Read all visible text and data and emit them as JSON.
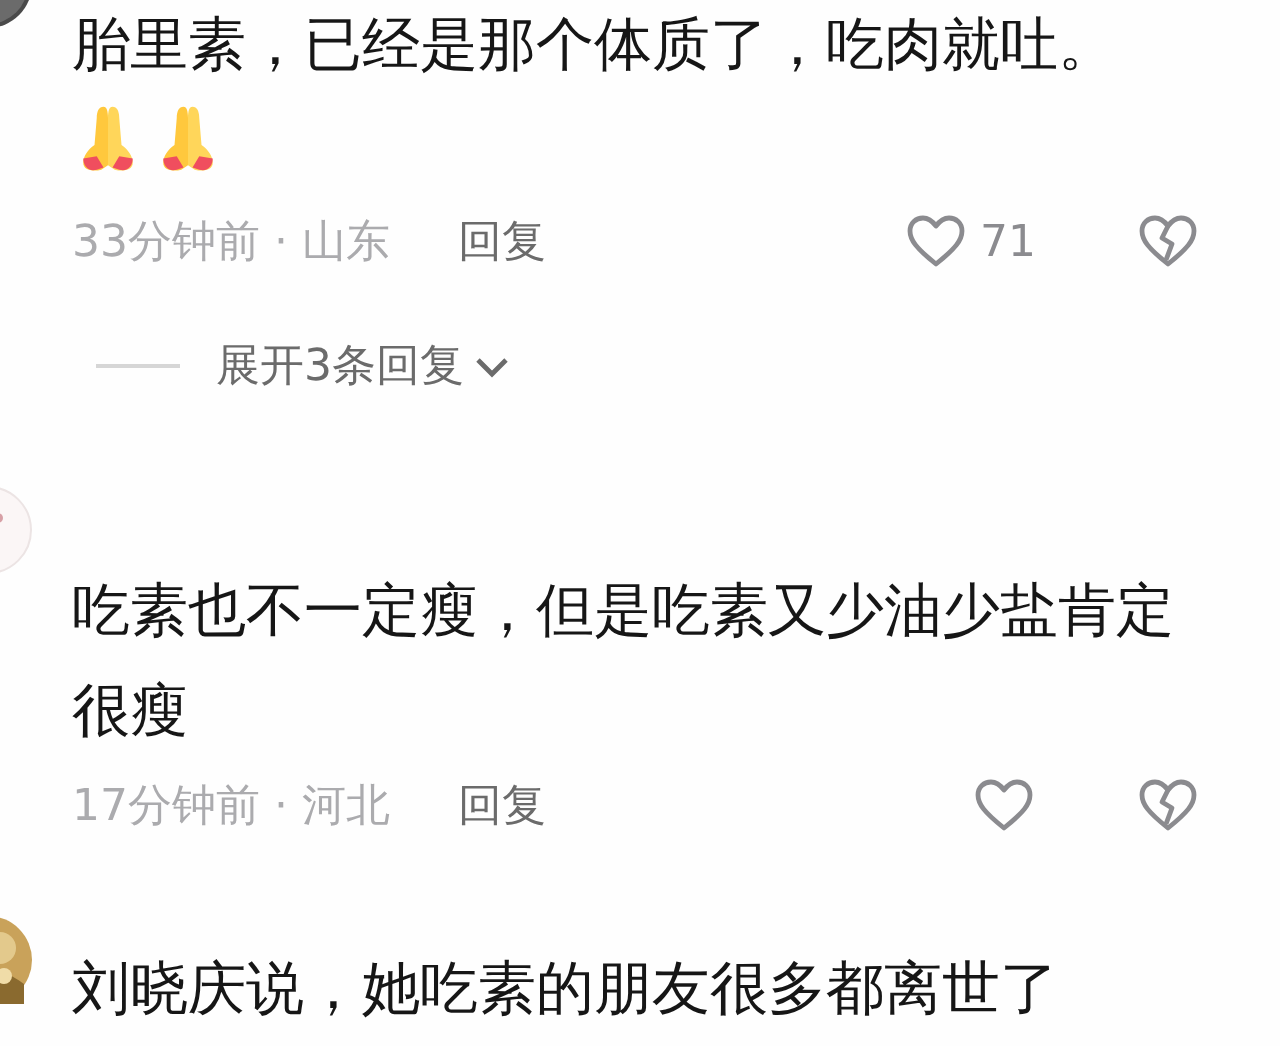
{
  "comments": [
    {
      "kind": "emoji",
      "text": "胎里素，已经是那个体质了，吃肉就吐。",
      "meta": "33分钟前 · 山东",
      "reply": "回复",
      "likes": "71",
      "expand": "展开3条回复"
    },
    {
      "kind": "text",
      "text": "吃素也不一定瘦，但是吃素又少油少盐肯定很瘦",
      "meta": "17分钟前 · 河北",
      "reply": "回复"
    },
    {
      "kind": "text",
      "text": "刘晓庆说，她吃素的朋友很多都离世了"
    }
  ]
}
